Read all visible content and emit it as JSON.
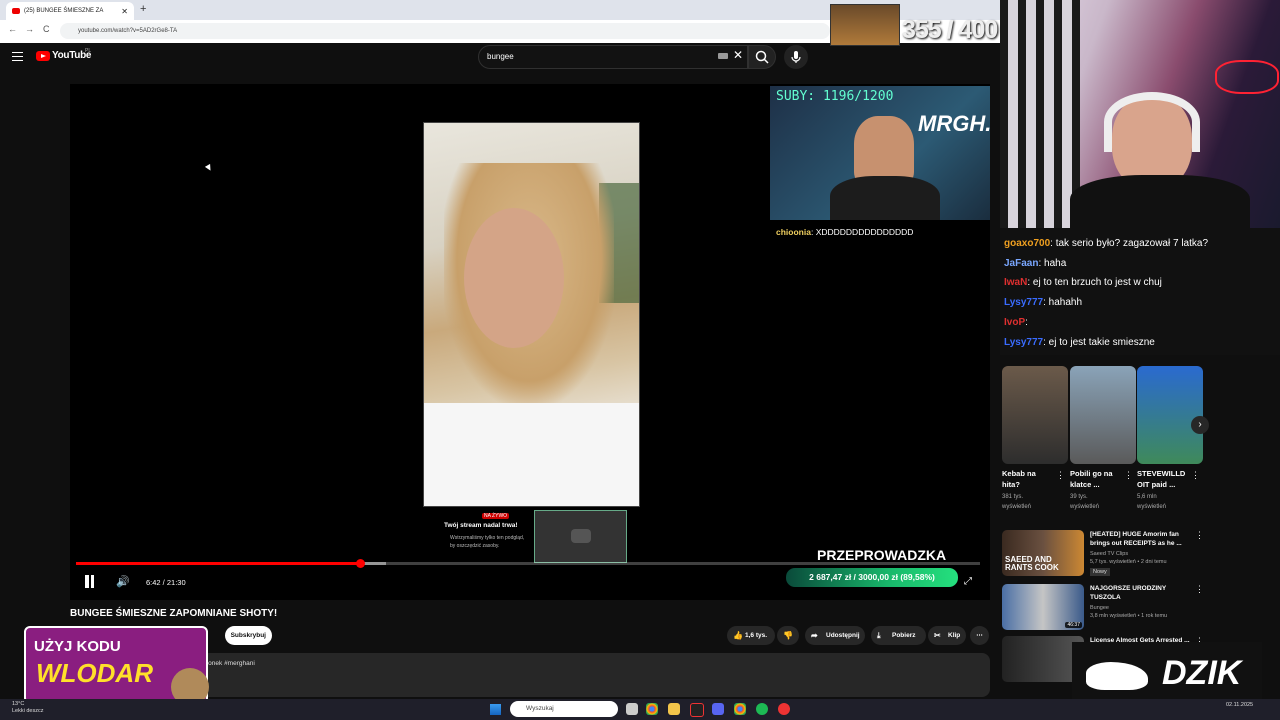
{
  "browser": {
    "tab_title": "(25) BUNGEE ŚMIESZNE ZA",
    "new_tab": "+",
    "url": "youtube.com/watch?v=5AD2rGe8-TA",
    "back": "←",
    "forward": "→",
    "reload": "C"
  },
  "youtube": {
    "logo": "YouTube",
    "region": "PL",
    "search_value": "bungee",
    "clear": "✕"
  },
  "player": {
    "subs_counter": "SUBY: 1196/1200",
    "cam_brand": "MRGH.",
    "chat_user": "chioonia",
    "chat_text": "XDDDDDDDDDDDDDDD",
    "live_badge": "NA ŻYWO",
    "live_title": "Twój stream nadal trwa!",
    "live_desc": "Wstrzymaliśmy tylko ten podgląd, by oszczędzić zasoby.",
    "banner": "PRZEPROWADZKA",
    "time": "6:42 / 21:30",
    "progress_fraction": 0.314,
    "donation": "2 687,47 zł / 3000,00 zł (89,58%)"
  },
  "video": {
    "title": "BUNGEE ŚMIESZNE ZAPOMNIANE SHOTY!",
    "subscribe": "Subskrybuj",
    "likes": "1,6 tys.",
    "share": "Udostępnij",
    "download": "Pobierz",
    "clip": "Klip",
    "more": "⋯",
    "description": "ronek #merghani"
  },
  "ad": {
    "line1": "UŻYJ KODU",
    "line2": "WLODAR"
  },
  "overlay": {
    "counter": "355 / 400",
    "counter_img_label": "WŁODARY WLEDARA"
  },
  "chat": [
    {
      "user": "goaxo700",
      "color": "#f0a020",
      "text": "tak serio było? zagazował 7 latka?"
    },
    {
      "user": "JaFaan",
      "color": "#7aa7ff",
      "text": "haha"
    },
    {
      "user": "IwaN",
      "color": "#e03030",
      "text": "ej to ten brzuch to jest w chuj"
    },
    {
      "user": "Lysy777",
      "color": "#3a6cff",
      "text": "hahahh"
    },
    {
      "user": "IvoP",
      "color": "#e03030",
      "text": ""
    },
    {
      "user": "Lysy777",
      "color": "#3a6cff",
      "text": "ej to jest takie smieszne"
    }
  ],
  "shorts": [
    {
      "title": "Kebab na hita?",
      "views": "381 tys.",
      "unit": "wyświetleń"
    },
    {
      "title": "Pobili go na klatce ...",
      "views": "39 tys.",
      "unit": "wyświetleń"
    },
    {
      "title": "STEVEWILLD OIT paid ...",
      "views": "5,6 mln",
      "unit": "wyświetleń"
    }
  ],
  "recs": [
    {
      "title": "[HEATED] HUGE Amorim fan brings out RECEIPTS as he ...",
      "channel": "Saeed TV Clips",
      "meta": "5,7 tys. wyświetleń • 2 dni temu",
      "badge": "Nowy",
      "thumb_text": "SAEED AND RANTS COOK"
    },
    {
      "title": "NAJGORSZE URODZINY TUSZOLA",
      "channel": "Bungee",
      "meta": "3,8 mln wyświetleń • 1 rok temu",
      "badge": "46:37",
      "thumb_text": ""
    },
    {
      "title": "License Almost Gets Arrested ...",
      "channel": "",
      "meta": "",
      "badge": "",
      "thumb_text": ""
    }
  ],
  "sponsor": "DZIK",
  "taskbar": {
    "temp": "13°C",
    "weather": "Lekki deszcz",
    "search_placeholder": "Wyszukaj",
    "date": "02.11.2025"
  },
  "colors": {
    "yt_red": "#ff0000",
    "accent_green": "#25e07e",
    "ad_purple": "#8a1e80"
  }
}
